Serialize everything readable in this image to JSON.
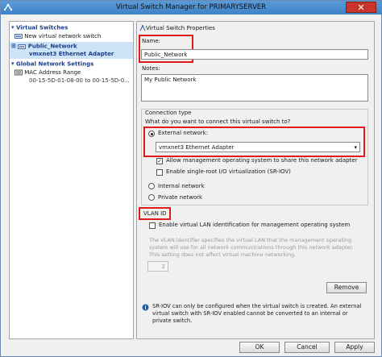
{
  "window": {
    "title": "Virtual Switch Manager for PRIMARYSERVER",
    "close": "✕"
  },
  "tree": {
    "virtual_switches_header": "Virtual Switches",
    "new_switch": "New virtual network switch",
    "public_network": "Public_Network",
    "adapter_sub": "vmxnet3 Ethernet Adapter",
    "global_settings_header": "Global Network Settings",
    "mac_range_label": "MAC Address Range",
    "mac_range_value": "00-15-5D-01-08-00 to 00-15-5D-0..."
  },
  "props": {
    "section_title": "Virtual Switch Properties",
    "name_label": "Name:",
    "name_value": "Public_Network",
    "notes_label": "Notes:",
    "notes_value": "My Public Network",
    "connection_type_label": "Connection type",
    "connection_question": "What do you want to connect this virtual switch to?",
    "external_label": "External network:",
    "adapter_selected": "vmxnet3 Ethernet Adapter",
    "allow_mgmt_label": "Allow management operating system to share this network adapter",
    "sriov_label": "Enable single-root I/O virtualization (SR-IOV)",
    "internal_label": "Internal network",
    "private_label": "Private network",
    "vlan_title": "VLAN ID",
    "vlan_enable_label": "Enable virtual LAN identification for management operating system",
    "vlan_description": "The VLAN identifier specifies the virtual LAN that the management operating system will use for all network communications through this network adapter. This setting does not affect virtual machine networking.",
    "vlan_value": "2",
    "remove_label": "Remove",
    "info_text": "SR-IOV can only be configured when the virtual switch is created. An external virtual switch with SR-IOV enabled cannot be converted to an internal or private switch."
  },
  "buttons": {
    "ok": "OK",
    "cancel": "Cancel",
    "apply": "Apply"
  },
  "colors": {
    "highlight_red": "#e11b1b",
    "selection_blue": "#cde3f7",
    "titlebar_blue": "#3f82c6"
  }
}
